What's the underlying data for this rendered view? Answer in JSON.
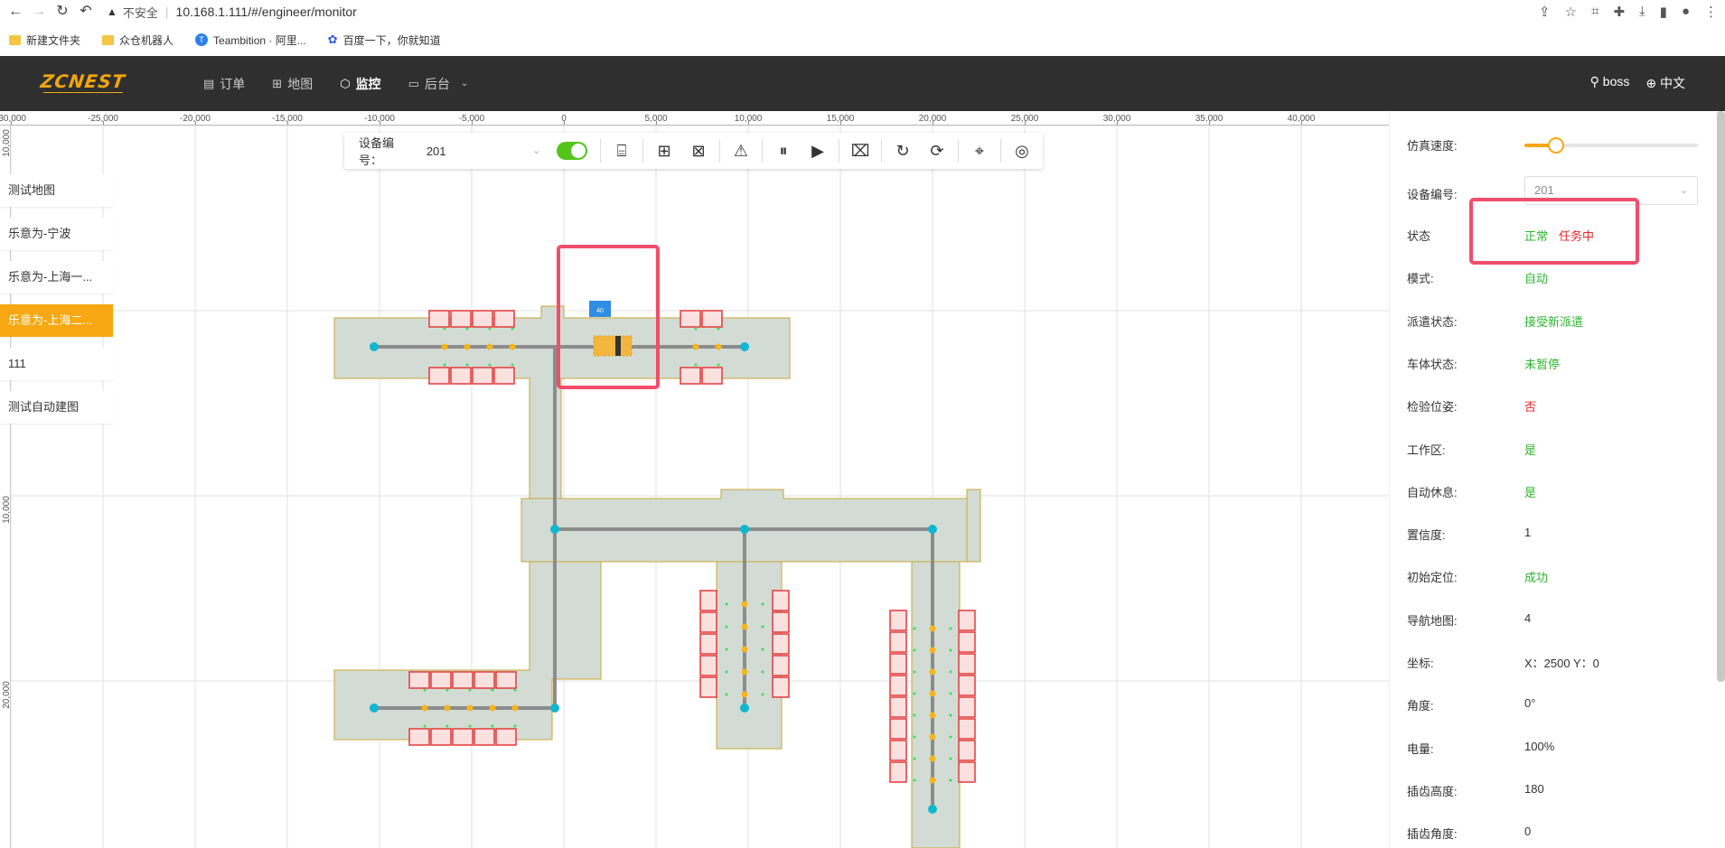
{
  "browser": {
    "insecure_label": "不安全",
    "url": "10.168.1.111/#/engineer/monitor",
    "bookmarks": [
      "新建文件夹",
      "众仓机器人",
      "Teambition · 阿里...",
      "百度一下，你就知道"
    ]
  },
  "header": {
    "logo": "ZCNEST",
    "menu": [
      {
        "label": "订单",
        "icon": "document-icon"
      },
      {
        "label": "地图",
        "icon": "sitemap-icon"
      },
      {
        "label": "监控",
        "icon": "cube-icon"
      },
      {
        "label": "后台",
        "icon": "monitor-icon"
      }
    ],
    "active_menu": "监控",
    "user": "boss",
    "language": "中文"
  },
  "ruler": {
    "x_ticks": [
      "-30,000",
      "-25,000",
      "-20,000",
      "-15,000",
      "-10,000",
      "-5,000",
      "0",
      "5,000",
      "10,000",
      "15,000",
      "20,000",
      "25,000",
      "30,000",
      "35,000",
      "40,000"
    ],
    "y_ticks": [
      "10,000",
      "10,000",
      "20,000"
    ]
  },
  "map_list": [
    "测试地图",
    "乐意为-宁波",
    "乐意为-上海一...",
    "乐意为-上海二...",
    "111",
    "测试自动建图"
  ],
  "active_map": "乐意为-上海二...",
  "toolbar": {
    "device_label": "设备编号：",
    "device_value": "201",
    "toggle_on": true
  },
  "robot": {
    "badge": "40"
  },
  "panel": {
    "sim_speed_label": "仿真速度:",
    "sim_speed_fraction": 0.18,
    "device_label": "设备编号:",
    "device_value": "201",
    "rows": [
      {
        "label": "状态",
        "value": "",
        "color": "green"
      },
      {
        "label": "模式:",
        "value": "自动",
        "color": "green"
      },
      {
        "label": "派遣状态:",
        "value": "接受新派遣",
        "color": "green"
      },
      {
        "label": "车体状态:",
        "value": "未暂停",
        "color": "green"
      },
      {
        "label": "检验位姿:",
        "value": "否",
        "color": "red"
      },
      {
        "label": "工作区:",
        "value": "是",
        "color": "green"
      },
      {
        "label": "自动休息:",
        "value": "是",
        "color": "green"
      },
      {
        "label": "置信度:",
        "value": "1",
        "color": "plain"
      },
      {
        "label": "初始定位:",
        "value": "成功",
        "color": "green"
      },
      {
        "label": "导航地图:",
        "value": "4",
        "color": "plain"
      },
      {
        "label": "坐标:",
        "value": "X：2500 Y：0",
        "color": "plain"
      },
      {
        "label": "角度:",
        "value": "0°",
        "color": "plain"
      },
      {
        "label": "电量:",
        "value": "100%",
        "color": "plain"
      },
      {
        "label": "插齿高度:",
        "value": "180",
        "color": "plain"
      },
      {
        "label": "插齿角度:",
        "value": "0",
        "color": "plain"
      }
    ],
    "status_normal": "正常",
    "status_task": "任务中"
  },
  "colors": {
    "accent": "#f7a812",
    "header_bg": "#2f2f2f",
    "area_fill": "#d3dcd4",
    "highlight": "#f04e6b"
  }
}
